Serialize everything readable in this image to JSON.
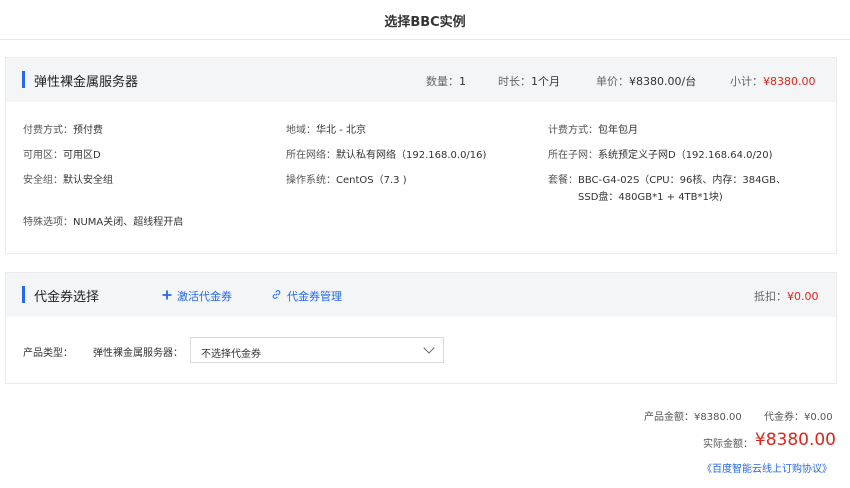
{
  "page": {
    "title": "选择BBC实例"
  },
  "server_card": {
    "title": "弹性裸金属服务器",
    "quantity_label": "数量：",
    "quantity": "1",
    "duration_label": "时长：",
    "duration": "1个月",
    "unit_price_label": "单价：",
    "unit_price": "¥8380.00/台",
    "subtotal_label": "小计：",
    "subtotal": "¥8380.00",
    "details": {
      "billing_label": "付费方式：",
      "billing": "预付费",
      "region_label": "地域：",
      "region": "华北 - 北京",
      "charge_label": "计费方式：",
      "charge": "包年包月",
      "zone_label": "可用区：",
      "zone": "可用区D",
      "network_label": "所在网络：",
      "network": "默认私有网络（192.168.0.0/16)",
      "subnet_label": "所在子网：",
      "subnet": "系统预定义子网D（192.168.64.0/20)",
      "security_label": "安全组：",
      "security": "默认安全组",
      "os_label": "操作系统：",
      "os": "CentOS（7.3 )",
      "package_label": "套餐：",
      "package_line1": "BBC-G4-02S（CPU：96核、内存：384GB、",
      "package_line2": "SSD盘：480GB*1 + 4TB*1块)",
      "special_label": "特殊选项：",
      "special": "NUMA关闭、超线程开启"
    }
  },
  "voucher_card": {
    "title": "代金券选择",
    "activate_label": "激活代金券",
    "manage_label": "代金券管理",
    "deduct_label": "抵扣：",
    "deduct": "¥0.00",
    "product_type_label": "产品类型：",
    "product_name_label": "弹性裸金属服务器：",
    "select_value": "不选择代金券"
  },
  "summary": {
    "product_amount_label": "产品金额：",
    "product_amount": "¥8380.00",
    "voucher_label": "代金券：",
    "voucher": "¥0.00",
    "actual_label": "实际金额：",
    "actual": "¥8380.00",
    "agreement": "《百度智能云线上订购协议》"
  },
  "colors": {
    "accent": "#2468f2",
    "price": "#e1251b",
    "header_bg": "#f4f5f7"
  }
}
